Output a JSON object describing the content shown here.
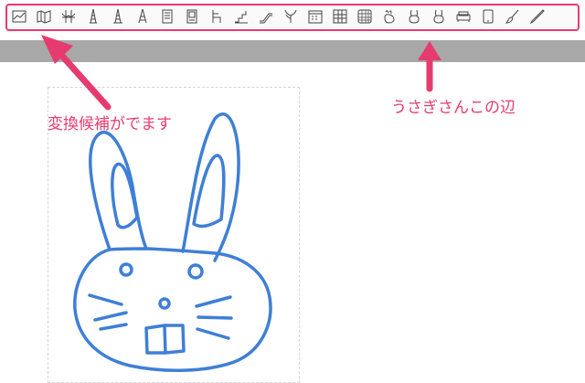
{
  "toolbar": {
    "buttons": [
      {
        "name": "line-chart-icon"
      },
      {
        "name": "map-icon"
      },
      {
        "name": "bridge-icon"
      },
      {
        "name": "tower-icon"
      },
      {
        "name": "tower-icon-2"
      },
      {
        "name": "tower-icon-3"
      },
      {
        "name": "building-icon"
      },
      {
        "name": "building-icon-2"
      },
      {
        "name": "chair-icon"
      },
      {
        "name": "stairs-icon"
      },
      {
        "name": "escalator-icon"
      },
      {
        "name": "plant-icon"
      },
      {
        "name": "calendar-icon"
      },
      {
        "name": "grid-icon"
      },
      {
        "name": "grid-icon-2"
      },
      {
        "name": "rabbit-icon"
      },
      {
        "name": "rabbit-face-icon"
      },
      {
        "name": "rabbit-face-icon-2"
      },
      {
        "name": "sofa-icon"
      },
      {
        "name": "tablet-icon"
      },
      {
        "name": "brush-icon"
      },
      {
        "name": "pen-icon"
      }
    ]
  },
  "annotations": {
    "left_note": "変換候補がでます",
    "right_note": "うさぎさんこの辺"
  },
  "colors": {
    "accent": "#e63b6e",
    "drawing_stroke": "#3f7fd6",
    "band": "#a8a8a8"
  }
}
